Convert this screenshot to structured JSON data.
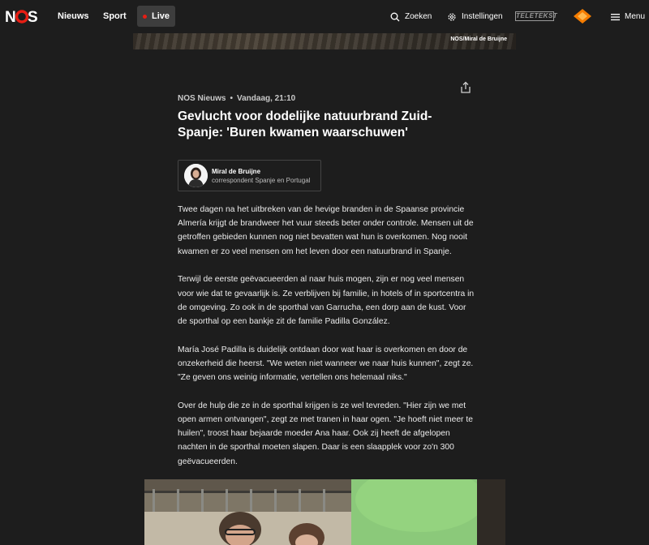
{
  "nav": {
    "logo": "NOS",
    "links": [
      "Nieuws",
      "Sport"
    ],
    "live_label": "Live",
    "search_label": "Zoeken",
    "settings_label": "Instellingen",
    "teletekst_label": "TELETEKST",
    "menu_label": "Menu",
    "colors": {
      "brand": "#e61e14",
      "background": "#1d1d1d"
    }
  },
  "hero": {
    "credit": "NOS/Miral de Bruijne"
  },
  "article": {
    "source": "NOS Nieuws",
    "time": "Vandaag, 21:10",
    "title": "Gevlucht voor dodelijke natuurbrand Zuid-Spanje: 'Buren kwamen waarschuwen'",
    "author": {
      "name": "Miral de Bruijne",
      "role": "correspondent Spanje en Portugal"
    },
    "paragraphs": [
      "Twee dagen na het uitbreken van de hevige branden in de Spaanse provincie Almería krijgt de brandweer het vuur steeds beter onder controle. Mensen uit de getroffen gebieden kunnen nog niet bevatten wat hun is overkomen. Nog nooit kwamen er zo veel mensen om het leven door een natuurbrand in Spanje.",
      "Terwijl de eerste geëvacueerden al naar huis mogen, zijn er nog veel mensen voor wie dat te gevaarlijk is. Ze verblijven bij familie, in hotels of in sportcentra in de omgeving. Zo ook in de sporthal van Garrucha, een dorp aan de kust. Voor de sporthal op een bankje zit de familie Padilla González.",
      "María José Padilla is duidelijk ontdaan door wat haar is overkomen en door de onzekerheid die heerst. \"We weten niet wanneer we naar huis kunnen\", zegt ze. \"Ze geven ons weinig informatie, vertellen ons helemaal niks.\"",
      "Over de hulp die ze in de sporthal krijgen is ze wel tevreden. \"Hier zijn we met open armen ontvangen\", zegt ze met tranen in haar ogen. \"Je hoeft niet meer te huilen\", troost haar bejaarde moeder Ana haar. Ook zij heeft de afgelopen nachten in de sporthal moeten slapen. Daar is een slaapplek voor zo'n 300 geëvacueerden."
    ]
  }
}
